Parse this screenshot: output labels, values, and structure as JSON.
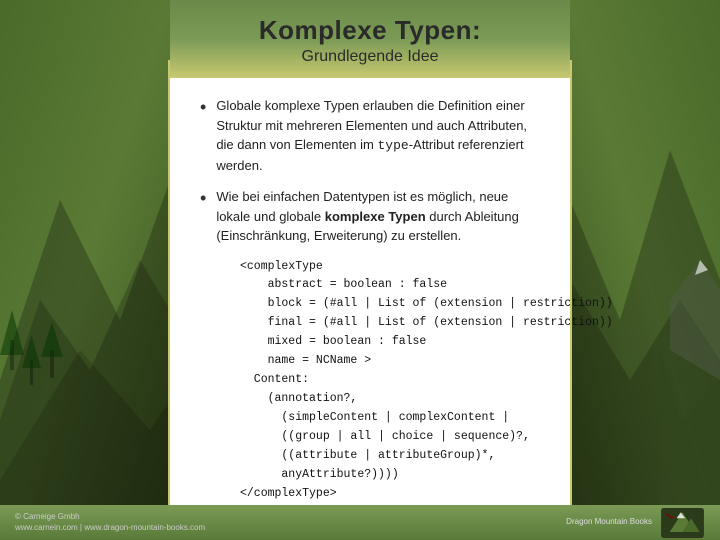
{
  "slide": {
    "header": {
      "title": "Komplexe Typen:",
      "subtitle": "Grundlegende Idee"
    },
    "bullets": [
      {
        "id": "bullet1",
        "text": "Globale komplexe Typen erlauben die Definition einer Struktur mit mehreren Elementen und auch Attributen, die dann von Elementen im type-Attribut referenziert werden."
      },
      {
        "id": "bullet2",
        "text": "Wie bei einfachen Datentypen ist es möglich, neue lokale und globale komplexe Typen durch Ableitung (Einschränkung, Erweiterung) zu erstellen."
      }
    ],
    "code": {
      "lines": [
        "<complexType",
        "    abstract = boolean : false",
        "    block = (#all | List of (extension | restriction))",
        "    final = (#all | List of (extension | restriction))",
        "    mixed = boolean : false",
        "    name = NCName >",
        "  Content:",
        "    (annotation?,",
        "      (simpleContent | complexContent |",
        "      ((group | all | choice | sequence)?,",
        "      ((attribute | attributeGroup)*,",
        "      anyAttribute?))))",
        "</complexType>"
      ]
    },
    "footer": {
      "left_line1": "© Carneige Gmbh",
      "left_line2": "www.carnein.com | www.dragon-mountain-books.com",
      "right_line1": "Dragon Mountain Books",
      "right_brand": "Dragon Mountain Books"
    },
    "colors": {
      "header_gradient_start": "#6b8a4a",
      "header_gradient_end": "#c8c870",
      "accent": "#c8c870",
      "bg": "#f0f0f0"
    }
  }
}
